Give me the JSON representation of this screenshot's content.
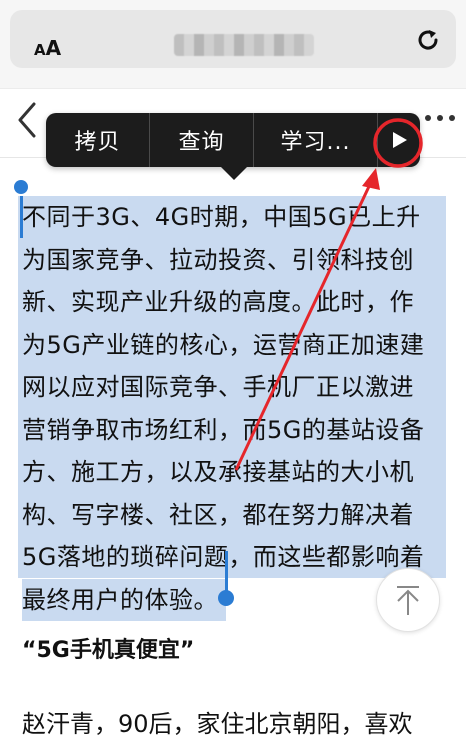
{
  "browser": {
    "text_size_label_small": "A",
    "text_size_label_large": "A",
    "reload_icon": "reload-icon"
  },
  "nav": {
    "back_icon": "chevron-left-icon",
    "more_icon": "ellipsis-icon"
  },
  "edit_menu": {
    "copy": "拷贝",
    "lookup": "查询",
    "learn": "学习...",
    "next_icon": "play-triangle-icon"
  },
  "article": {
    "selected_lines": [
      "不同于3G、4G时期，中国5G已上升",
      "为国家竞争、拉动投资、引领科技创",
      "新、实现产业升级的高度。此时，作",
      "为5G产业链的核心，运营商正加速建",
      "网以应对国际竞争、手机厂正以激进",
      "营销争取市场红利，而5G的基站设备",
      "方、施工方，以及承接基站的大小机",
      "构、写字楼、社区，都在努力解决着",
      "5G落地的琐碎问题，而这些都影响着",
      "最终用户的体验。"
    ],
    "heading": "“5G手机真便宜”",
    "next_line": "赵汗青，90后，家住北京朝阳，喜欢"
  },
  "colors": {
    "selection": "#c9daf0",
    "handle": "#2b7cd3",
    "menu_bg": "#1c1c1c",
    "annotation": "#e5262b"
  }
}
